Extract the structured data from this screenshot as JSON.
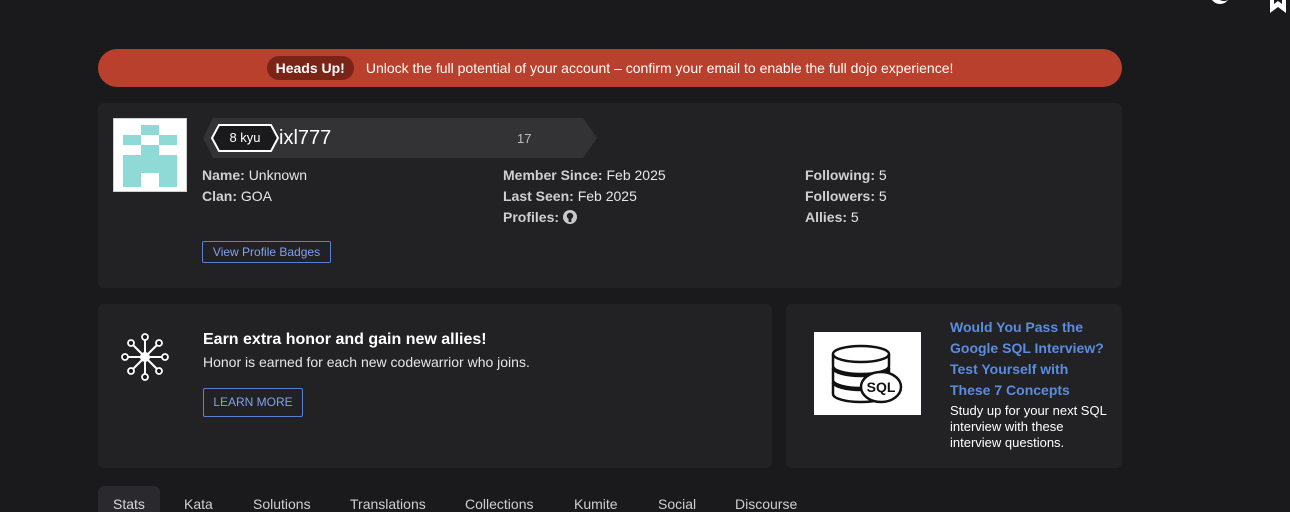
{
  "banner": {
    "pill": "Heads Up!",
    "message": "Unlock the full potential of your account – confirm your email to enable the full dojo experience!"
  },
  "profile": {
    "rank": "8 kyu",
    "username": "ixl777",
    "honor": "17",
    "details_left": [
      {
        "label": "Name:",
        "value": "Unknown"
      },
      {
        "label": "Clan:",
        "value": "GOA"
      }
    ],
    "details_mid": [
      {
        "label": "Member Since:",
        "value": "Feb 2025"
      },
      {
        "label": "Last Seen:",
        "value": "Feb 2025"
      },
      {
        "label": "Profiles:",
        "icon": "github-icon"
      }
    ],
    "details_right": [
      {
        "label": "Following:",
        "value": "5"
      },
      {
        "label": "Followers:",
        "value": "5"
      },
      {
        "label": "Allies:",
        "value": "5"
      }
    ],
    "badges_button": "View Profile Badges"
  },
  "invite": {
    "title": "Earn extra honor and gain new allies!",
    "subtitle": "Honor is earned for each new codewarrior who joins.",
    "button": "LEARN MORE"
  },
  "ad": {
    "title": "Would You Pass the Google SQL Interview? Test Yourself with These 7 Concepts",
    "description": "Study up for your next SQL interview with these interview questions.",
    "icon": "sql-database-icon"
  },
  "tabs": [
    "Stats",
    "Kata",
    "Solutions",
    "Translations",
    "Collections",
    "Kumite",
    "Social",
    "Discourse"
  ],
  "colors": {
    "banner": "#b9402c",
    "card": "#222225",
    "link": "#5a8ce0",
    "background": "#1a1a1c"
  }
}
